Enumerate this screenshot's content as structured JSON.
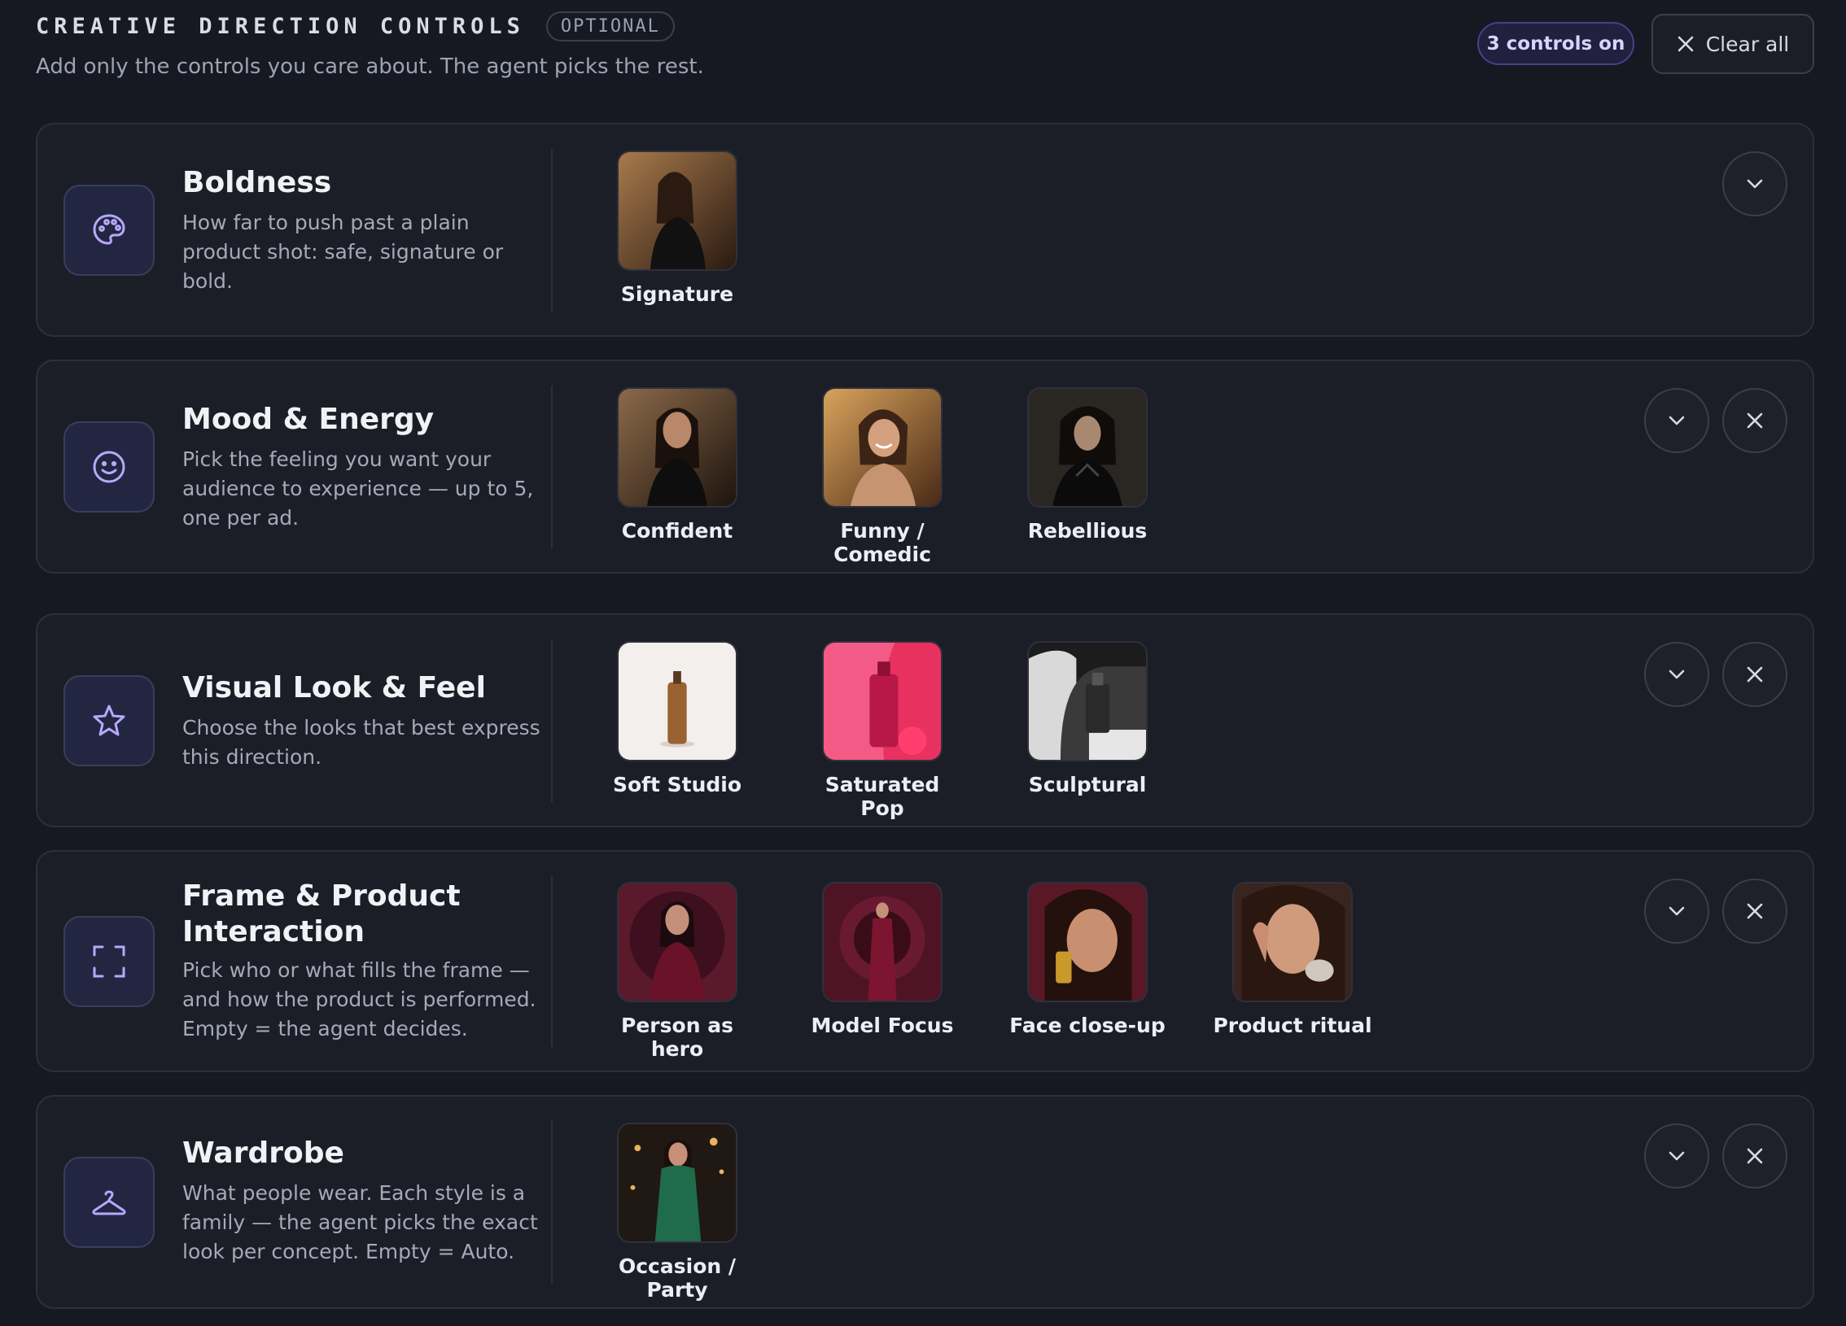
{
  "header": {
    "title": "CREATIVE DIRECTION CONTROLS",
    "badge": "OPTIONAL",
    "subtitle": "Add only the controls you care about. The agent picks the rest.",
    "controls_on": "3 controls on",
    "clear_all": "Clear all"
  },
  "accent_color": "#9b8cff",
  "cards": [
    {
      "icon": "palette-icon",
      "title": "Boldness",
      "description": "How far to push past a plain product shot: safe, signature or bold.",
      "removable": false,
      "options": [
        {
          "label": "Signature"
        }
      ]
    },
    {
      "icon": "smile-icon",
      "title": "Mood & Energy",
      "description": "Pick the feeling you want your audience to experience — up to 5, one per ad.",
      "removable": true,
      "options": [
        {
          "label": "Confident"
        },
        {
          "label": "Funny / Comedic"
        },
        {
          "label": "Rebellious"
        }
      ]
    },
    {
      "icon": "star-icon",
      "title": "Visual Look & Feel",
      "description": "Choose the looks that best express this direction.",
      "removable": true,
      "options": [
        {
          "label": "Soft Studio"
        },
        {
          "label": "Saturated Pop"
        },
        {
          "label": "Sculptural"
        }
      ]
    },
    {
      "icon": "frame-icon",
      "title": "Frame & Product Interaction",
      "description": "Pick who or what fills the frame — and how the product is performed. Empty = the agent decides.",
      "removable": true,
      "options": [
        {
          "label": "Person as hero"
        },
        {
          "label": "Model Focus"
        },
        {
          "label": "Face close-up"
        },
        {
          "label": "Product ritual"
        }
      ]
    },
    {
      "icon": "hanger-icon",
      "title": "Wardrobe",
      "description": "What people wear. Each style is a family — the agent picks the exact look per concept. Empty = Auto.",
      "removable": true,
      "options": [
        {
          "label": "Occasion / Party"
        }
      ]
    }
  ]
}
